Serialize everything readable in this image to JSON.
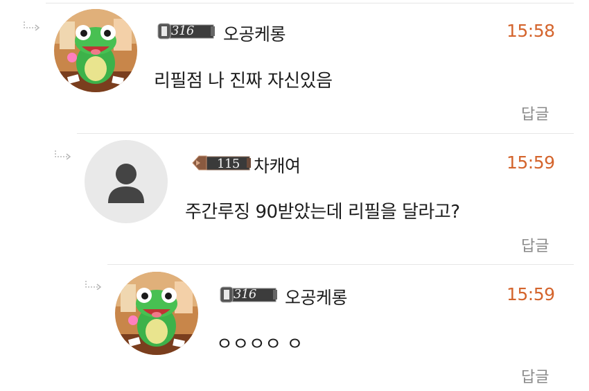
{
  "comments": [
    {
      "nickname": "오공케롱",
      "level": "316",
      "time": "15:58",
      "text": "리필점 나  진짜 자신있음",
      "reply_label": "답글",
      "avatar": "frog-avatar",
      "badge_icon": "gem-level-badge-icon"
    },
    {
      "nickname": "차캐여",
      "level": "115",
      "time": "15:59",
      "text": "주간루징 90받았는데 리필을 달라고?",
      "reply_label": "답글",
      "avatar": "default-user-avatar",
      "badge_icon": "shield-level-badge-icon"
    },
    {
      "nickname": "오공케롱",
      "level": "316",
      "time": "15:59",
      "text": "ㅇㅇㅇㅇ ㅇ",
      "reply_label": "답글",
      "avatar": "frog-avatar",
      "badge_icon": "gem-level-badge-icon"
    }
  ],
  "colors": {
    "time": "#d4642c",
    "reply": "#8a8a8a",
    "divider": "#e6e6e6"
  }
}
